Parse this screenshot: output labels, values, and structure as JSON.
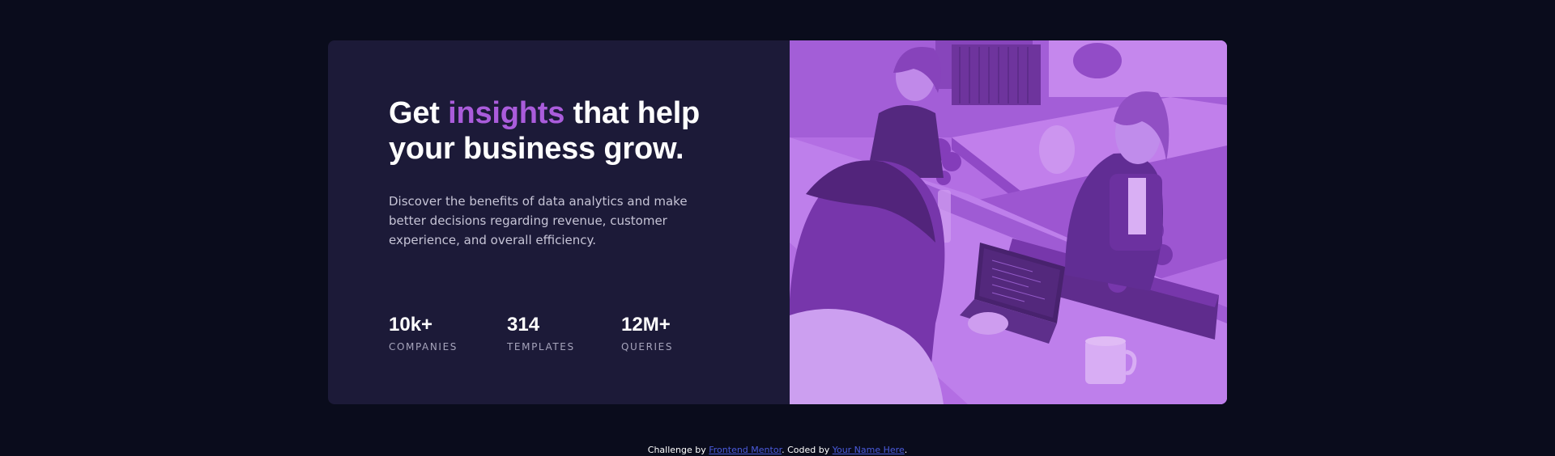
{
  "colors": {
    "page_background": "#0a0c1c",
    "card_background": "#1c1a38",
    "accent": "#aa5cdb",
    "image_overlay": "#aa5cdb",
    "link": "#4a5bdc"
  },
  "hero": {
    "headline_prefix": "Get ",
    "headline_accent": "insights",
    "headline_suffix": " that help your business grow.",
    "description": "Discover the benefits of data analytics and make better decisions regarding revenue, customer experience, and overall efficiency."
  },
  "stats": [
    {
      "value": "10k+",
      "label": "COMPANIES"
    },
    {
      "value": "314",
      "label": "TEMPLATES"
    },
    {
      "value": "12M+",
      "label": "QUERIES"
    }
  ],
  "image": {
    "alt": "people-working-at-office-table-photo"
  },
  "attribution": {
    "prefix": "Challenge by ",
    "link1": "Frontend Mentor",
    "middle": ". Coded by ",
    "link2": "Your Name Here",
    "suffix": "."
  }
}
